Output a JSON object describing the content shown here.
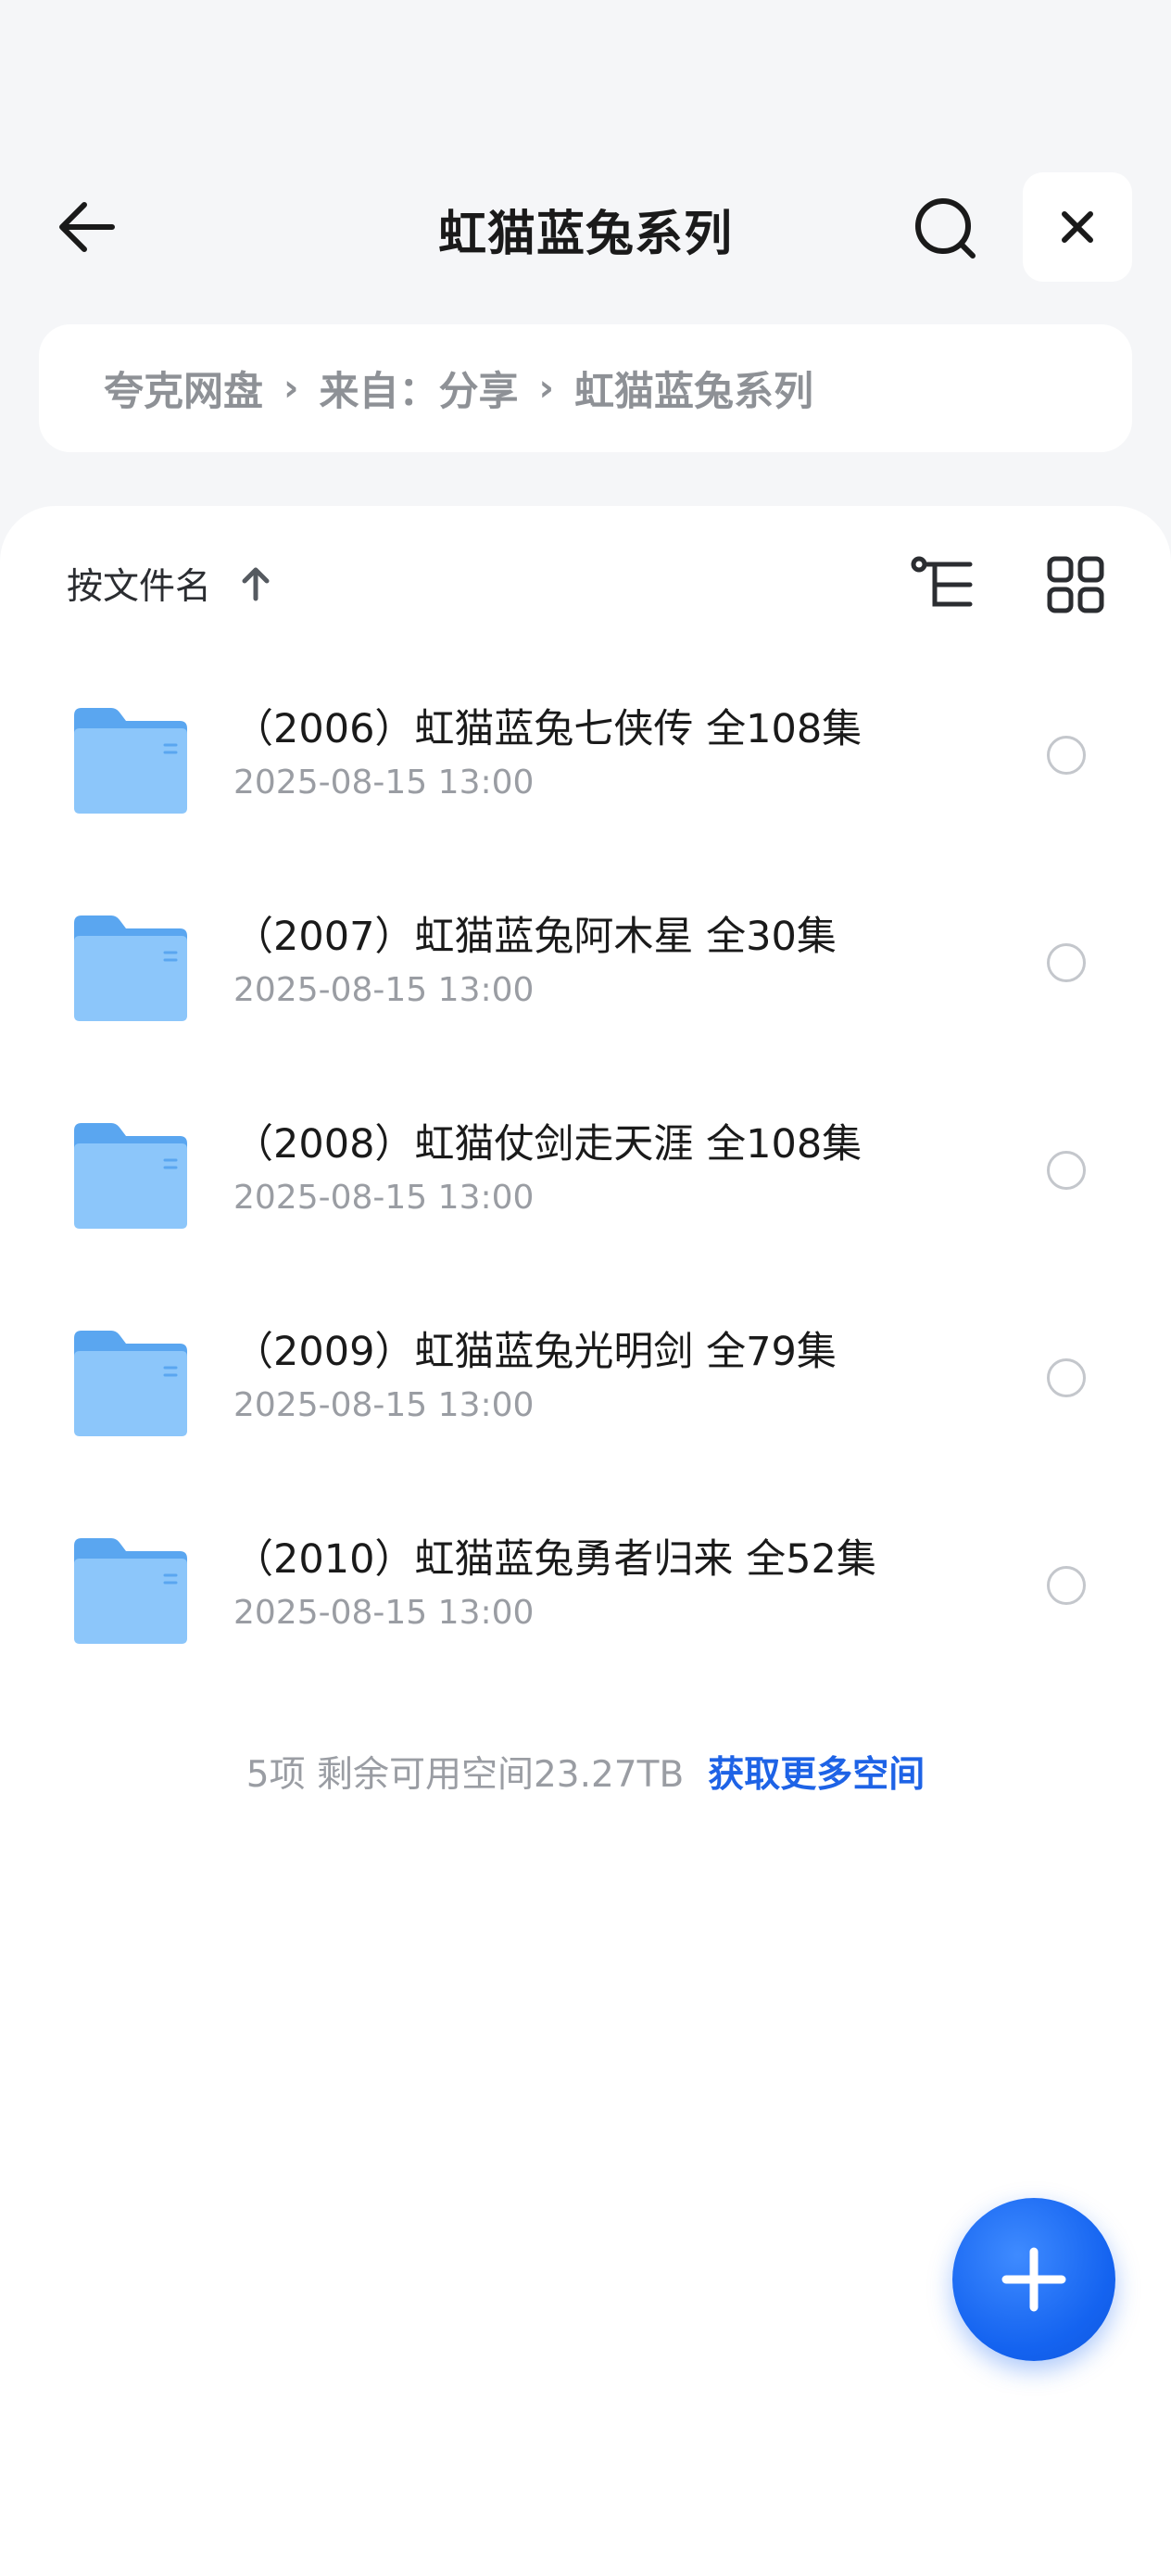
{
  "header": {
    "title": "虹猫蓝兔系列"
  },
  "breadcrumb": {
    "items": [
      "夸克网盘",
      "来自：分享",
      "虹猫蓝兔系列"
    ],
    "separator": "›"
  },
  "sortbar": {
    "label": "按文件名"
  },
  "files": [
    {
      "name": "（2006）虹猫蓝兔七侠传  全108集",
      "date": "2025-08-15 13:00"
    },
    {
      "name": "（2007）虹猫蓝兔阿木星  全30集",
      "date": "2025-08-15 13:00"
    },
    {
      "name": "（2008）虹猫仗剑走天涯  全108集",
      "date": "2025-08-15 13:00"
    },
    {
      "name": "（2009）虹猫蓝兔光明剑  全79集",
      "date": "2025-08-15 13:00"
    },
    {
      "name": "（2010）虹猫蓝兔勇者归来  全52集",
      "date": "2025-08-15 13:00"
    }
  ],
  "footer": {
    "info": "5项 剩余可用空间23.27TB",
    "more_space_link": "获取更多空间"
  },
  "icons": {
    "back": "arrow-left-icon",
    "search": "search-icon",
    "close": "close-icon",
    "sort_direction": "arrow-up-icon",
    "tree": "tree-structure-icon",
    "grid": "grid-view-icon",
    "folder": "folder-icon",
    "fab": "plus-icon"
  },
  "colors": {
    "accent": "#1e63e6",
    "folder": "#72b4f5",
    "background": "#f5f6f8"
  }
}
